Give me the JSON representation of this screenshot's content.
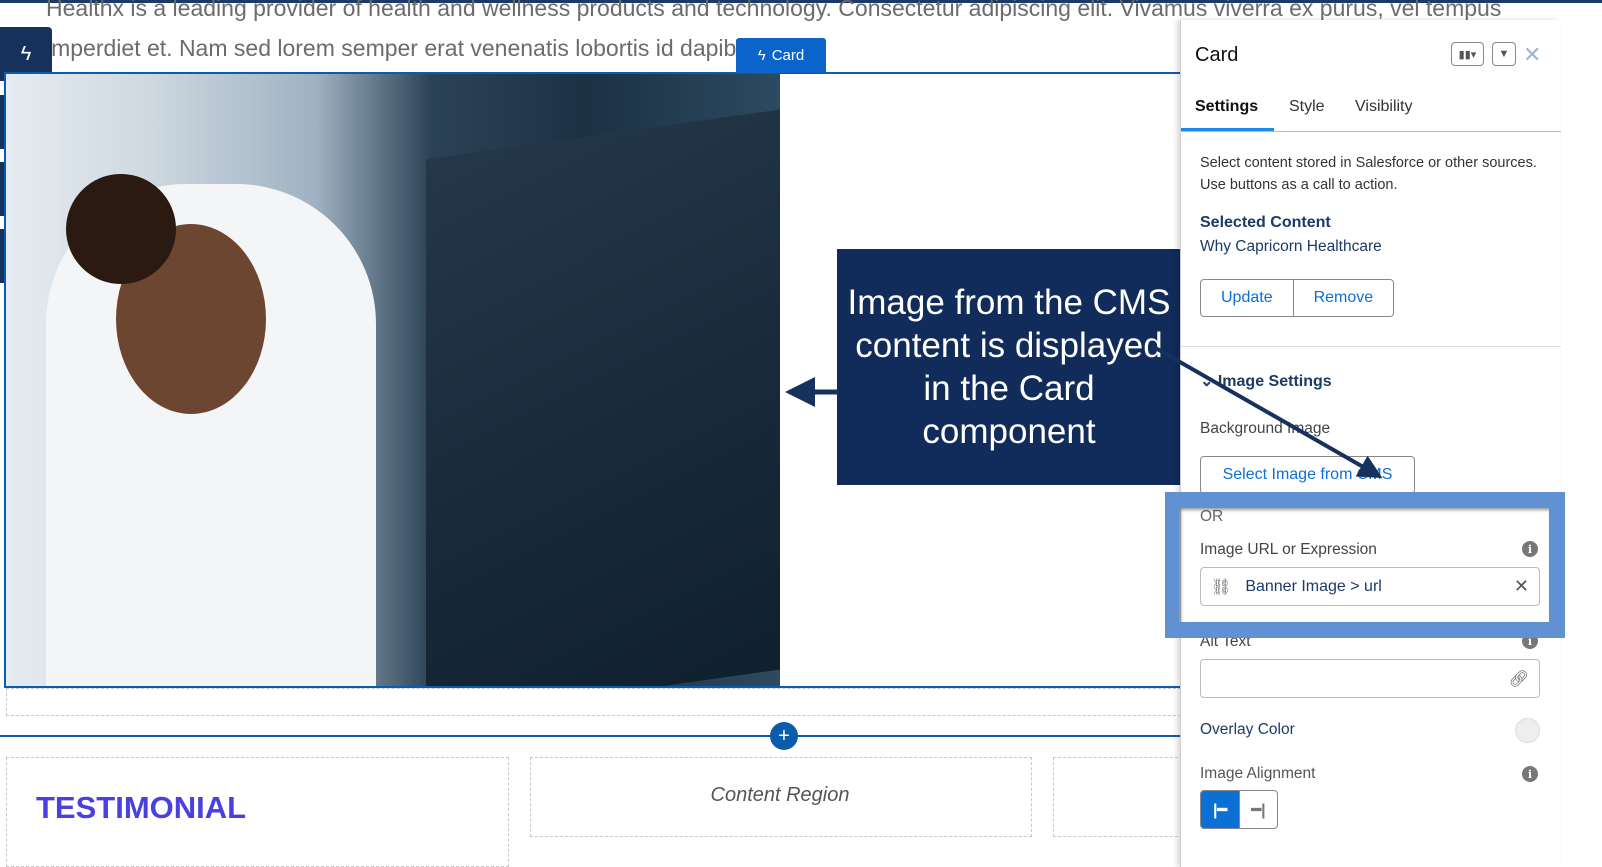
{
  "page": {
    "body_text_line1": "Healthx is a leading provider of health and wellness products and technology. Consectetur adipiscing elit. Vivamus viverra ex purus, vel tempus lectus",
    "body_text_line2": "imperdiet et. Nam sed lorem semper erat venenatis lobortis id dapibus dui.",
    "card_tag": "Card",
    "testimonial_heading": "TESTIMONIAL",
    "content_region": "Content Region",
    "add_icon": "+"
  },
  "left_toolbar": [
    {
      "icon": "lightning-icon",
      "glyph": "ϟ"
    },
    {
      "icon": "brush-icon",
      "glyph": "✎"
    },
    {
      "icon": "list-icon",
      "glyph": "☰"
    },
    {
      "icon": "gear-icon",
      "glyph": "⚙"
    }
  ],
  "callout": {
    "text": "Image from the CMS content is displayed in the Card component",
    "background": "#112c5a"
  },
  "panel": {
    "title": "Card",
    "tabs": [
      {
        "label": "Settings",
        "active": true
      },
      {
        "label": "Style"
      },
      {
        "label": "Visibility"
      }
    ],
    "description": "Select content stored in Salesforce or other sources. Use buttons as a call to action.",
    "selected_content_label": "Selected Content",
    "selected_content_value": "Why Capricorn Healthcare",
    "update_label": "Update",
    "remove_label": "Remove",
    "image_settings_label": "Image Settings",
    "background_image_label": "Background Image",
    "select_image_label": "Select Image from CMS",
    "or_label": "OR",
    "image_url_label": "Image URL or Expression",
    "image_url_value": "Banner Image > url",
    "alt_text_label": "Alt Text",
    "alt_text_value": "",
    "overlay_color_label": "Overlay Color",
    "image_alignment_label": "Image Alignment",
    "alignment_selected": "left"
  },
  "colors": {
    "accent": "#0b6fd6",
    "highlight": "#5f91d3",
    "navy": "#16325c"
  }
}
